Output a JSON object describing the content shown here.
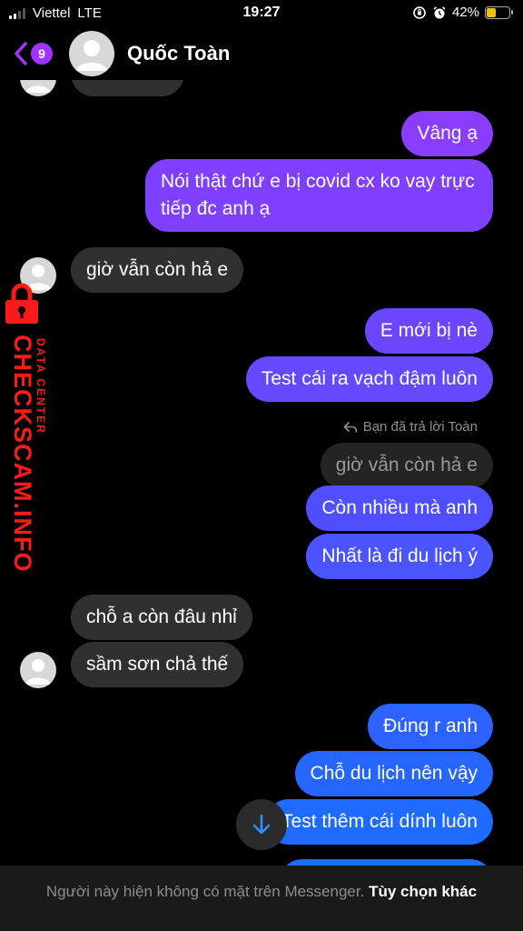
{
  "status_bar": {
    "carrier": "Viettel",
    "network": "LTE",
    "time": "19:27",
    "battery": "42%",
    "battery_level": 0.42
  },
  "header": {
    "unread_count": "9",
    "contact_name": "Quốc Toàn"
  },
  "colors": {
    "accent": "#8a3dff",
    "outgoing_top": "#8a3dff",
    "outgoing_bottom": "#1f6bff",
    "incoming": "#303030"
  },
  "messages": [
    {
      "id": "m1",
      "text": "Vâng ạ",
      "direction": "out"
    },
    {
      "id": "m2",
      "text": "Nói thật chứ e bị covid cx ko vay trực tiếp đc anh ạ",
      "direction": "out"
    },
    {
      "id": "m3",
      "text": "giờ vẫn còn hả e",
      "direction": "in"
    },
    {
      "id": "m4",
      "text": "E mới bị nè",
      "direction": "out"
    },
    {
      "id": "m5",
      "text": "Test cái ra vạch đậm luôn",
      "direction": "out"
    },
    {
      "id": "m6",
      "text": "Còn nhiều mà anh",
      "direction": "out"
    },
    {
      "id": "m7",
      "text": "Nhất là đi du lịch ý",
      "direction": "out"
    },
    {
      "id": "m8",
      "text": "chỗ a còn đâu nhỉ",
      "direction": "in"
    },
    {
      "id": "m9",
      "text": "sầm sơn chả thế",
      "direction": "in"
    },
    {
      "id": "m10",
      "text": "Đúng r anh",
      "direction": "out"
    },
    {
      "id": "m11",
      "text": "Chỗ du lịch nên vậy",
      "direction": "out"
    },
    {
      "id": "m12",
      "text": "Test thêm cái dính luôn",
      "direction": "out"
    }
  ],
  "reply": {
    "label": "Bạn đã trả lời Toàn",
    "quoted_text": "giờ vẫn còn hả e"
  },
  "watermark": {
    "main": "CHECKSCAM.INFO",
    "sub": "DATA CENTER"
  },
  "footer": {
    "notice": "Người này hiện không có mặt trên Messenger.",
    "action": "Tùy chọn khác"
  }
}
